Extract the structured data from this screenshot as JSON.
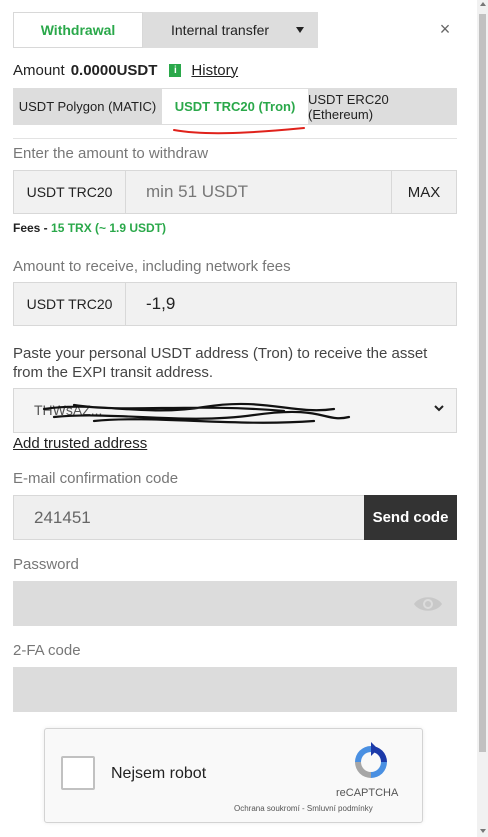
{
  "tabs": {
    "withdrawal": "Withdrawal",
    "internal": "Internal transfer"
  },
  "close_symbol": "×",
  "amount": {
    "label": "Amount",
    "value": "0.0000USDT",
    "info_icon": "i",
    "history": "History"
  },
  "networks": [
    {
      "label": "USDT Polygon (MATIC)",
      "active": false
    },
    {
      "label": "USDT TRC20 (Tron)",
      "active": true
    },
    {
      "label": "USDT ERC20 (Ethereum)",
      "active": false
    }
  ],
  "withdraw": {
    "label": "Enter the amount to withdraw",
    "currency": "USDT TRC20",
    "placeholder": "min 51 USDT",
    "max": "MAX"
  },
  "fees": {
    "label": "Fees - ",
    "value": "15 TRX (~ 1.9 USDT)"
  },
  "receive": {
    "label": "Amount to receive, including network fees",
    "currency": "USDT TRC20",
    "value": "-1,9"
  },
  "address": {
    "label": "Paste your personal USDT address (Tron) to receive the asset from the EXPI transit address.",
    "value": "THWsAZ...",
    "trusted_link": "Add trusted address"
  },
  "email_code": {
    "label": "E-mail confirmation code",
    "value": "241451",
    "send_button": "Send code"
  },
  "password": {
    "label": "Password",
    "value": ""
  },
  "twofa": {
    "label": "2-FA code",
    "value": ""
  },
  "captcha": {
    "label": "Nejsem robot",
    "brand": "reCAPTCHA",
    "privacy": "Ochrana soukromí",
    "separator": " - ",
    "terms": "Smluvní podmínky"
  },
  "colors": {
    "accent_green": "#2aa84a",
    "button_dark": "#333333",
    "field_grey": "#dcdcdc"
  }
}
